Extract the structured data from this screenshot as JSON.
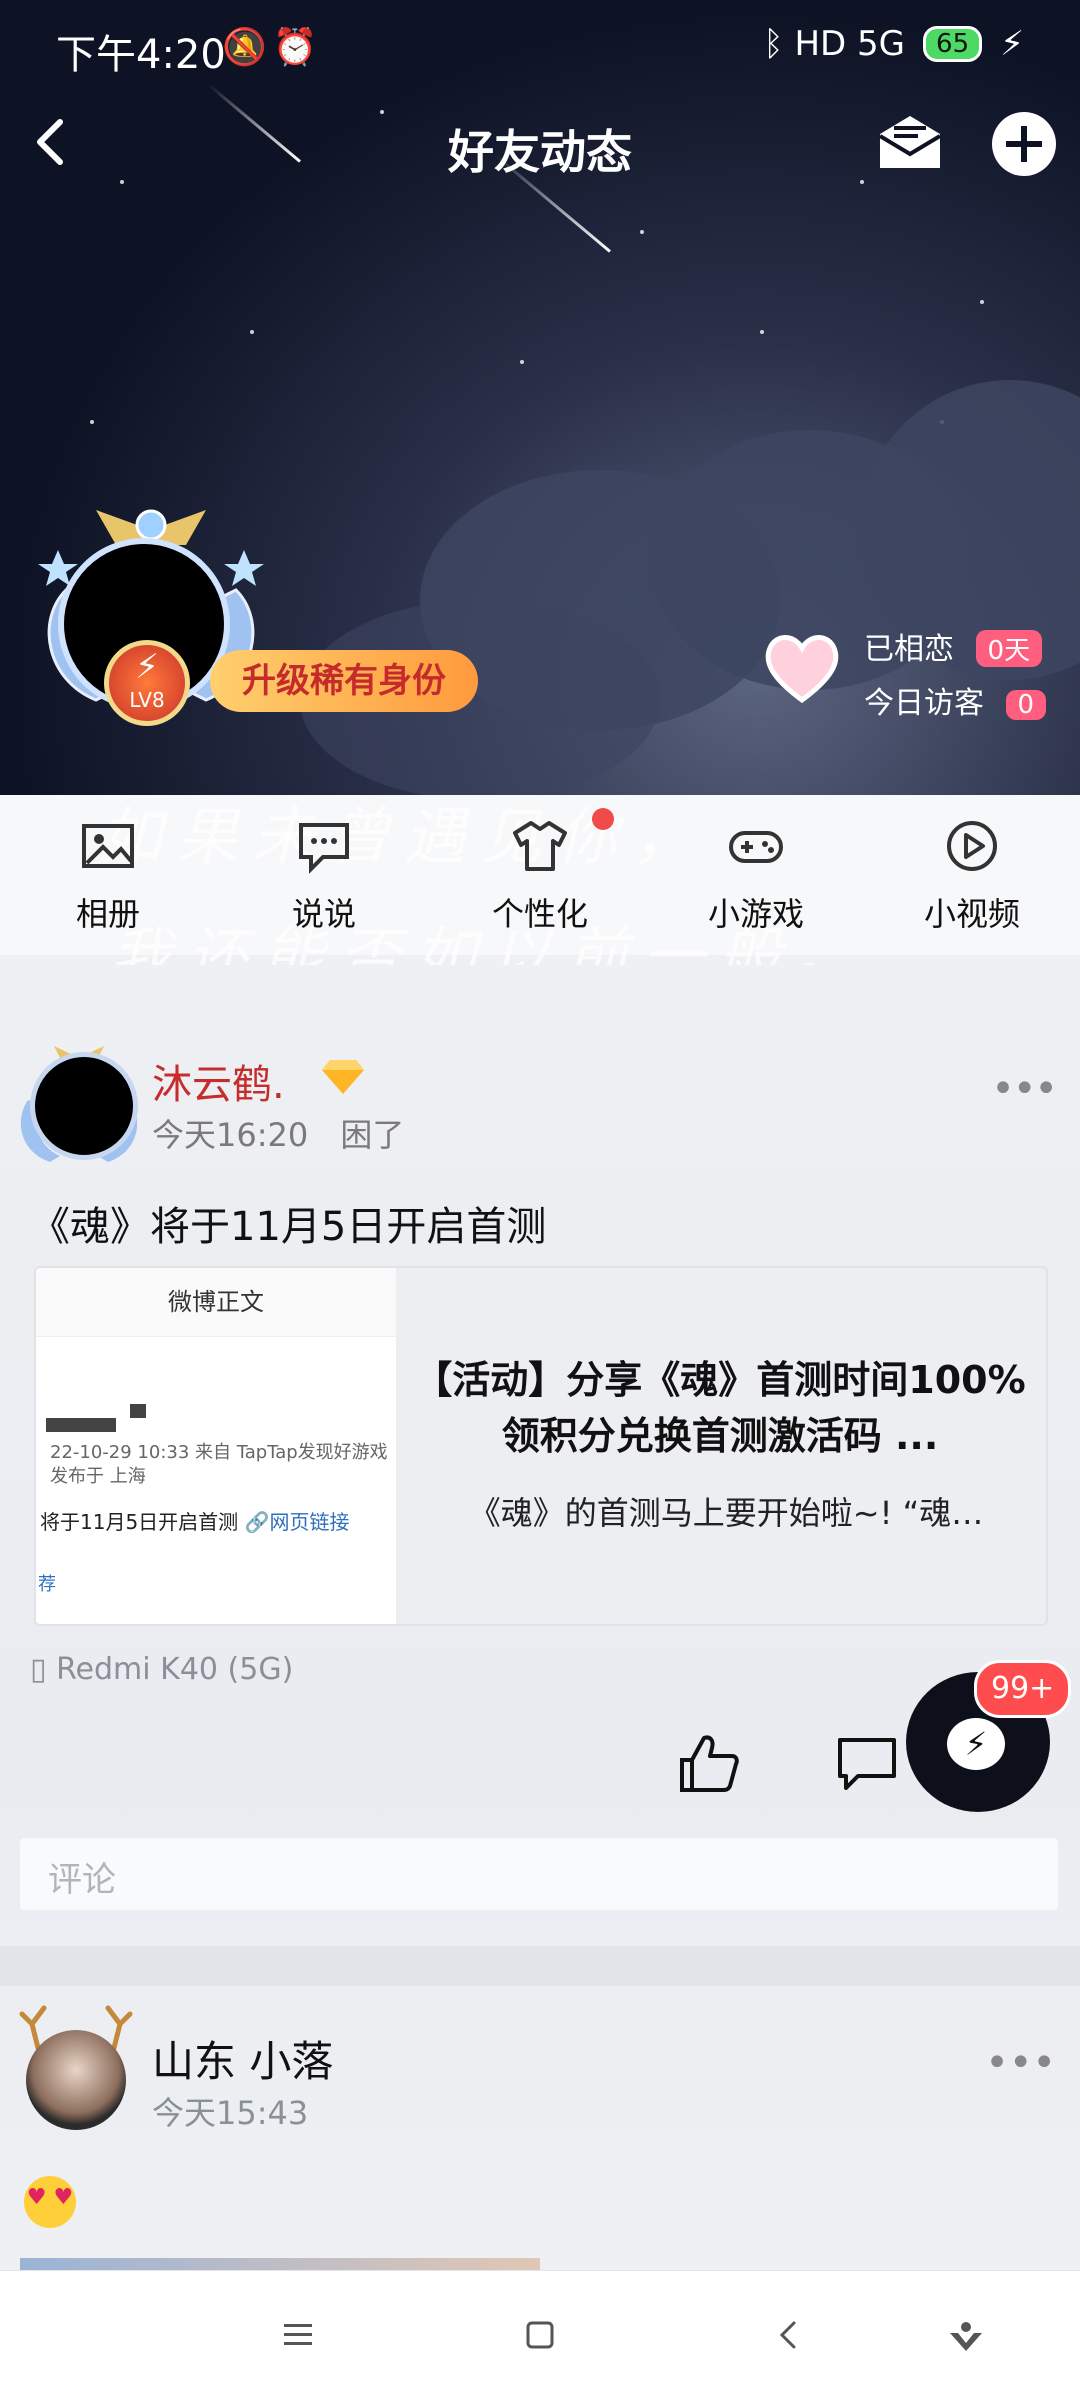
{
  "status_bar": {
    "time": "下午4:20",
    "left_icons": "🔕⏰",
    "right_icons": "ᛒ HD 5G",
    "battery": "65"
  },
  "header": {
    "title": "好友动态"
  },
  "profile": {
    "level": "LV8",
    "upgrade_label": "升级稀有身份",
    "stats": [
      {
        "label": "已相恋",
        "value": "0天"
      },
      {
        "label": "今日访客",
        "value": "0"
      }
    ]
  },
  "nav": {
    "items": [
      {
        "label": "相册",
        "icon": "image-icon"
      },
      {
        "label": "说说",
        "icon": "chat-bubble-icon"
      },
      {
        "label": "个性化",
        "icon": "shirt-icon"
      },
      {
        "label": "小游戏",
        "icon": "gamepad-icon"
      },
      {
        "label": "小视频",
        "icon": "play-icon"
      }
    ],
    "script_line1": "如果未曾遇见你，",
    "script_line2": "我还能否如以前一般。"
  },
  "post1": {
    "author": "沐云鹤.",
    "time": "今天16:20",
    "mood": "困了",
    "text": "《魂》将于11月5日开启首测",
    "card": {
      "thumb_header": "微博正文",
      "thumb_meta1": "22-10-29 10:33  来自 TapTap发现好游戏",
      "thumb_meta2": "发布于 上海",
      "thumb_body": "将于11月5日开启首测",
      "thumb_link": "🔗网页链接",
      "thumb_rec": "荐",
      "title": "【活动】分享《魂》首测时间100%领积分兑换首测激活码 ...",
      "desc": "《魂》的首测马上要开始啦~! “魂…"
    },
    "device": "Redmi K40 (5G)",
    "comment_placeholder": "评论"
  },
  "fab": {
    "badge": "99+"
  },
  "post2": {
    "author": "山东 小落",
    "time": "今天15:43"
  },
  "colors": {
    "author_red": "#c72c2c",
    "badge_red": "#ff4d4f",
    "link_blue": "#2f6fbd"
  }
}
